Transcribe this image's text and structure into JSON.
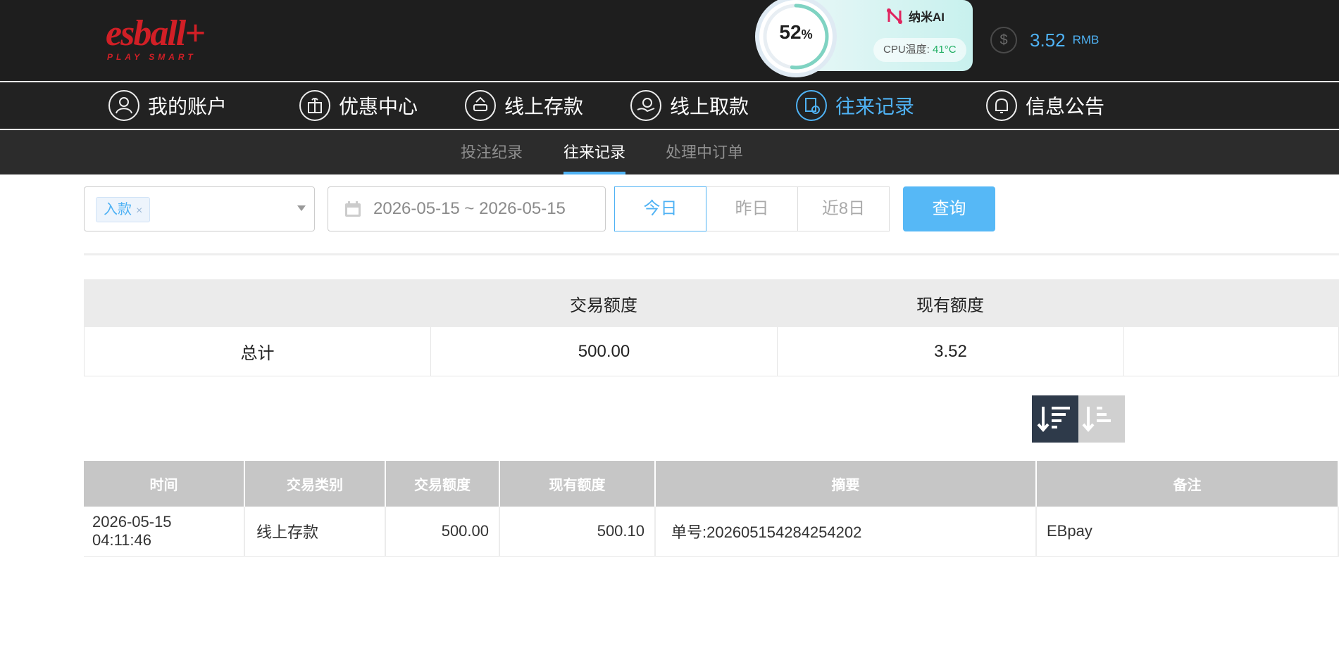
{
  "brand": {
    "logo_text": "esball+",
    "logo_tagline": "PLAY SMART"
  },
  "cpu_widget": {
    "percent": "52",
    "percent_unit": "%",
    "brand_name": "纳米AI",
    "temp_label": "CPU温度:",
    "temp_value": "41°C"
  },
  "balance": {
    "amount": "3.52",
    "currency": "RMB",
    "icon": "dollar-coin-icon"
  },
  "nav": [
    {
      "label": "我的账户",
      "icon": "user-icon"
    },
    {
      "label": "优惠中心",
      "icon": "gift-icon"
    },
    {
      "label": "线上存款",
      "icon": "deposit-icon"
    },
    {
      "label": "线上取款",
      "icon": "withdraw-icon"
    },
    {
      "label": "往来记录",
      "icon": "records-icon",
      "active": true
    },
    {
      "label": "信息公告",
      "icon": "bell-icon"
    }
  ],
  "subnav": [
    {
      "label": "投注纪录"
    },
    {
      "label": "往来记录",
      "active": true
    },
    {
      "label": "处理中订单"
    }
  ],
  "filters": {
    "type_tag": "入款",
    "type_tag_remove": "×",
    "date_range": "2026-05-15 ~ 2026-05-15",
    "quick": [
      "今日",
      "昨日",
      "近8日"
    ],
    "quick_selected": 0,
    "query_label": "查询"
  },
  "summary": {
    "headers": [
      "",
      "交易额度",
      "现有额度"
    ],
    "row": [
      "总计",
      "500.00",
      "3.52"
    ]
  },
  "records": {
    "headers": [
      "时间",
      "交易类别",
      "交易额度",
      "现有额度",
      "摘要",
      "备注"
    ],
    "rows": [
      [
        "2026-05-15 04:11:46",
        "线上存款",
        "500.00",
        "500.10",
        "单号:202605154284254202",
        "EBpay"
      ]
    ]
  },
  "colors": {
    "accent": "#4fb2f4",
    "brand_red": "#d11f26",
    "topbar": "#1e1e1e"
  }
}
